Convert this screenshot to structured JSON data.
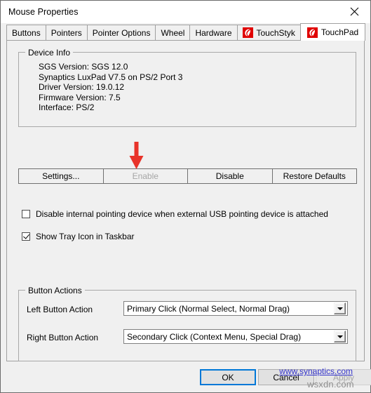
{
  "window": {
    "title": "Mouse Properties",
    "close_icon": "close-icon"
  },
  "tabs": [
    {
      "label": "Buttons",
      "icon": null,
      "selected": false
    },
    {
      "label": "Pointers",
      "icon": null,
      "selected": false
    },
    {
      "label": "Pointer Options",
      "icon": null,
      "selected": false
    },
    {
      "label": "Wheel",
      "icon": null,
      "selected": false
    },
    {
      "label": "Hardware",
      "icon": null,
      "selected": false
    },
    {
      "label": "TouchStyk",
      "icon": "synaptics-logo-icon",
      "selected": false
    },
    {
      "label": "TouchPad",
      "icon": "synaptics-logo-icon",
      "selected": true
    }
  ],
  "device_info": {
    "legend": "Device Info",
    "lines": [
      "SGS Version: SGS 12.0",
      "Synaptics LuxPad V7.5 on PS/2 Port 3",
      "Driver Version: 19.0.12",
      "Firmware Version: 7.5",
      "Interface: PS/2"
    ]
  },
  "annotation": {
    "arrow_color": "#e8332a",
    "points_at": "enable-button"
  },
  "action_buttons": [
    {
      "label": "Settings...",
      "disabled": false,
      "name": "settings-button"
    },
    {
      "label": "Enable",
      "disabled": true,
      "name": "enable-button"
    },
    {
      "label": "Disable",
      "disabled": false,
      "name": "disable-button"
    },
    {
      "label": "Restore Defaults",
      "disabled": false,
      "name": "restore-defaults-button"
    }
  ],
  "checkboxes": [
    {
      "label": "Disable internal pointing device when external USB pointing device is attached",
      "checked": false
    },
    {
      "label": "Show Tray Icon in Taskbar",
      "checked": true
    }
  ],
  "button_actions": {
    "legend": "Button Actions",
    "left": {
      "label": "Left Button Action",
      "value": "Primary Click (Normal Select, Normal Drag)"
    },
    "right": {
      "label": "Right Button Action",
      "value": "Secondary Click (Context Menu, Special Drag)"
    }
  },
  "link": {
    "text": "www.synaptics.com",
    "color": "#3333cc"
  },
  "footer": {
    "ok_label": "OK",
    "cancel_label": "Cancel",
    "apply_label": "Apply",
    "apply_disabled": true,
    "focus_color": "#0078d7"
  },
  "watermark": {
    "text": "wsxdn.com"
  }
}
